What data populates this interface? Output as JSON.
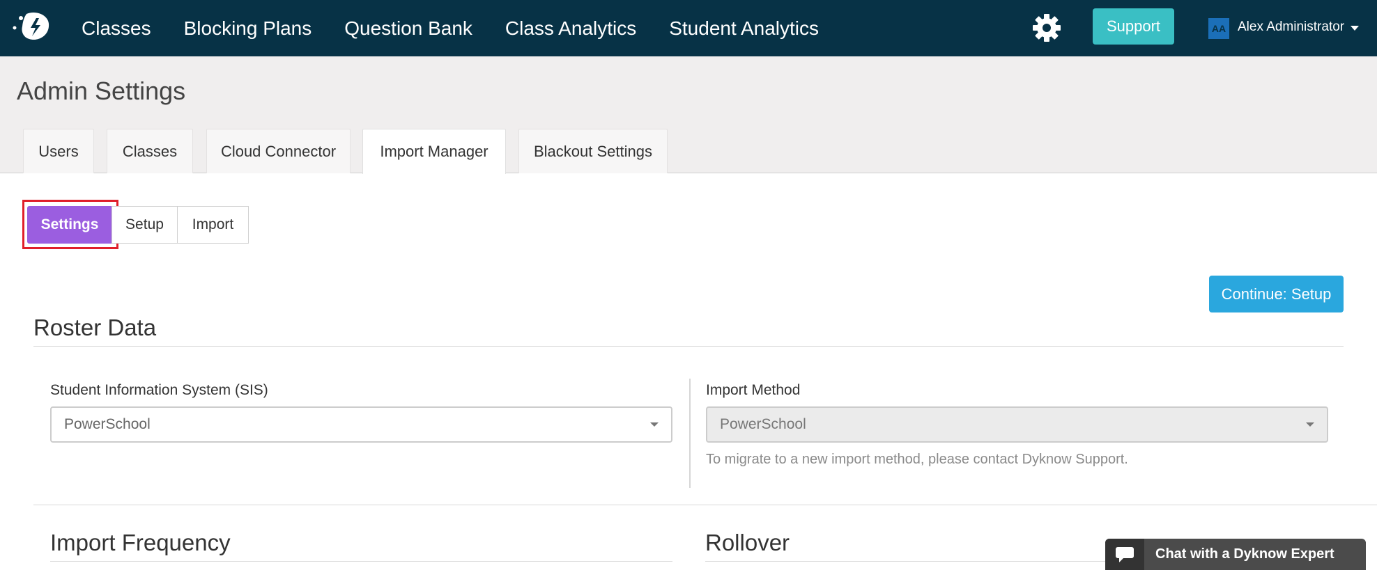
{
  "nav": {
    "links": [
      "Classes",
      "Blocking Plans",
      "Question Bank",
      "Class Analytics",
      "Student Analytics"
    ],
    "support_label": "Support",
    "avatar_initials": "AA",
    "user_name": "Alex Administrator",
    "icons": [
      "dyknow-logo-icon",
      "gear-icon",
      "chevron-down-icon"
    ]
  },
  "page": {
    "title": "Admin Settings",
    "tabs": [
      {
        "label": "Users",
        "active": false
      },
      {
        "label": "Classes",
        "active": false
      },
      {
        "label": "Cloud Connector",
        "active": false
      },
      {
        "label": "Import Manager",
        "active": true
      },
      {
        "label": "Blackout Settings",
        "active": false
      }
    ]
  },
  "subtabs": [
    {
      "label": "Settings",
      "active": true
    },
    {
      "label": "Setup",
      "active": false
    },
    {
      "label": "Import",
      "active": false
    }
  ],
  "continue_label": "Continue: Setup",
  "roster": {
    "title": "Roster Data",
    "sis_label": "Student Information System (SIS)",
    "sis_value": "PowerSchool",
    "method_label": "Import Method",
    "method_value": "PowerSchool",
    "method_help": "To migrate to a new import method, please contact Dyknow Support."
  },
  "frequency_title": "Import Frequency",
  "rollover_title": "Rollover",
  "chat_label": "Chat with a Dyknow Expert",
  "colors": {
    "navbar": "#073246",
    "support": "#3abfc4",
    "active_subtab": "#9b5ee0",
    "continue": "#2aa7de",
    "highlight": "#e01f2a"
  }
}
